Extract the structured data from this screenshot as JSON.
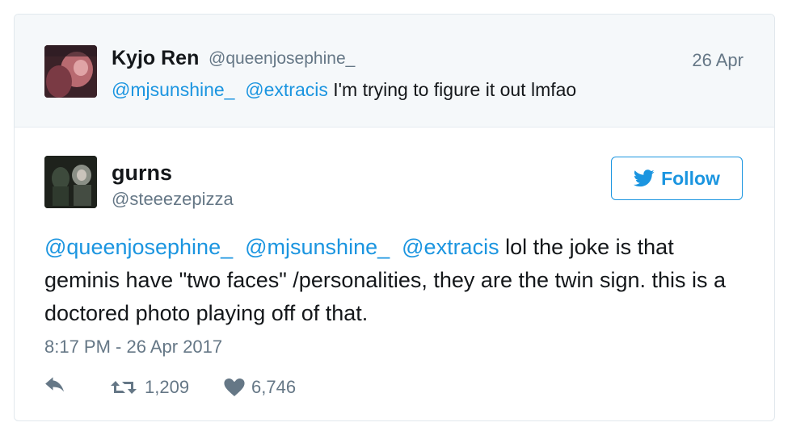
{
  "parent_tweet": {
    "name": "Kyjo Ren",
    "handle": "@queenjosephine_",
    "date": "26 Apr",
    "mentions": [
      "@mjsunshine_",
      "@extracis"
    ],
    "text": " I'm trying to figure it out lmfao"
  },
  "main_tweet": {
    "name": "gurns",
    "handle": "@steeezepizza",
    "follow_label": "Follow",
    "mentions": [
      "@queenjosephine_",
      "@mjsunshine_",
      "@extracis"
    ],
    "text": " lol the joke is that geminis have \"two faces\" /personalities, they are the twin sign. this is a doctored photo playing off of that.",
    "timestamp": "8:17 PM - 26 Apr 2017",
    "retweets": "1,209",
    "likes": "6,746"
  },
  "colors": {
    "link": "#1b95e0",
    "muted": "#657786",
    "text": "#14171a",
    "parent_bg": "#f5f8fa"
  },
  "icons": [
    "reply-icon",
    "retweet-icon",
    "heart-icon",
    "twitter-bird-icon"
  ]
}
